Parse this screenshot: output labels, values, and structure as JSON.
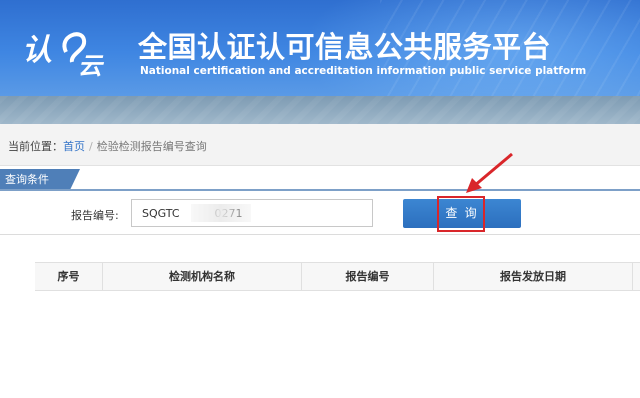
{
  "header": {
    "logo_text": "认云",
    "title_cn": "全国认证认可信息公共服务平台",
    "title_en": "National certification and accreditation information public service platform"
  },
  "breadcrumb": {
    "prefix": "当前位置：",
    "home": "首页",
    "separator": "/",
    "current": "检验检测报告编号查询"
  },
  "query_section": {
    "tab_label": "查询条件",
    "report_no_label": "报告编号:",
    "report_no_value": "SQGTC          0271",
    "search_button": "查 询"
  },
  "results_table": {
    "columns": [
      "序号",
      "检测机构名称",
      "报告编号",
      "报告发放日期"
    ]
  },
  "colors": {
    "header_blue": "#3f86e2",
    "button_blue": "#2c6fbe",
    "highlight_red": "#d9262a"
  }
}
